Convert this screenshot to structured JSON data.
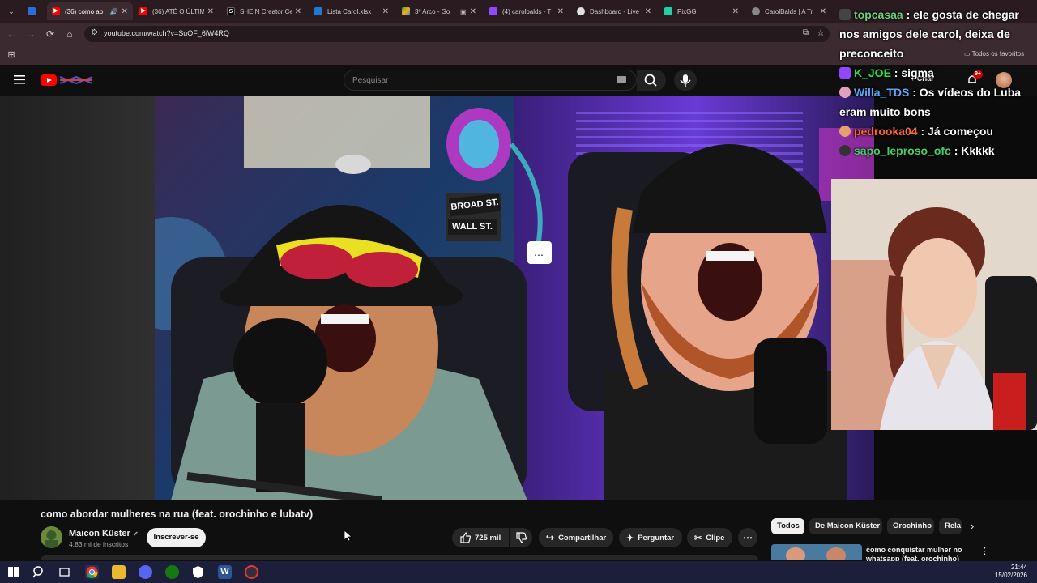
{
  "browser": {
    "tabs": [
      {
        "title": "",
        "icon": "gem-icon"
      },
      {
        "title": "(36) como ab",
        "icon": "youtube-icon",
        "audio": true
      },
      {
        "title": "(36) ATÉ O ÚLTIM",
        "icon": "youtube-icon"
      },
      {
        "title": "SHEIN Creator Ce",
        "icon": "shein-icon"
      },
      {
        "title": "Lista Carol.xlsx",
        "icon": "onedrive-icon"
      },
      {
        "title": "3º Arco - Go",
        "icon": "drive-icon"
      },
      {
        "title": "(4) carolbalds - T",
        "icon": "twitch-icon"
      },
      {
        "title": "Dashboard - Live",
        "icon": "dashboard-icon"
      },
      {
        "title": "PixGG",
        "icon": "pixgg-icon"
      },
      {
        "title": "CarolBalds | A Tr",
        "icon": "globe-icon"
      }
    ],
    "url": "youtube.com/watch?v=SuOF_6iW4RQ",
    "bookmarks_all": "Todos os favoritos"
  },
  "youtube": {
    "search_placeholder": "Pesquisar",
    "create_label": "Criar",
    "notification_count": "9+",
    "video": {
      "title": "como abordar mulheres na rua (feat. orochinho e lubatv)",
      "channel": "Maicon Küster",
      "subscribers": "4,83 mi de inscritos",
      "subscribe_label": "Inscrever-se",
      "likes": "725 mil",
      "share_label": "Compartilhar",
      "ask_label": "Perguntar",
      "clip_label": "Clipe",
      "overlay_text_1": "BROAD ST.",
      "overlay_text_2": "WALL ST."
    },
    "chips": [
      "Todos",
      "De Maicon Küster",
      "Orochinho",
      "Rela"
    ],
    "recommendation": {
      "title": "como conquistar mulher no whatsapp (feat. orochinho)"
    }
  },
  "chat": [
    {
      "user": "topcasaa",
      "message": "ele gosta de chegar nos amigos dele carol, deixa de preconceito",
      "color": "#6fd27a"
    },
    {
      "user": "K_JOE",
      "message": "sigma",
      "color": "#22e33b"
    },
    {
      "user": "Willa_TDS",
      "message": "Os vídeos do Luba eram muito bons",
      "color": "#5aa9ff"
    },
    {
      "user": "pedrooka04",
      "message": "Já começou",
      "color": "#ff6a2a"
    },
    {
      "user": "sapo_leproso_ofc",
      "message": "Kkkkk",
      "color": "#4ad06a"
    }
  ],
  "taskbar": {
    "time": "21:44",
    "date": "15/02/2026"
  }
}
